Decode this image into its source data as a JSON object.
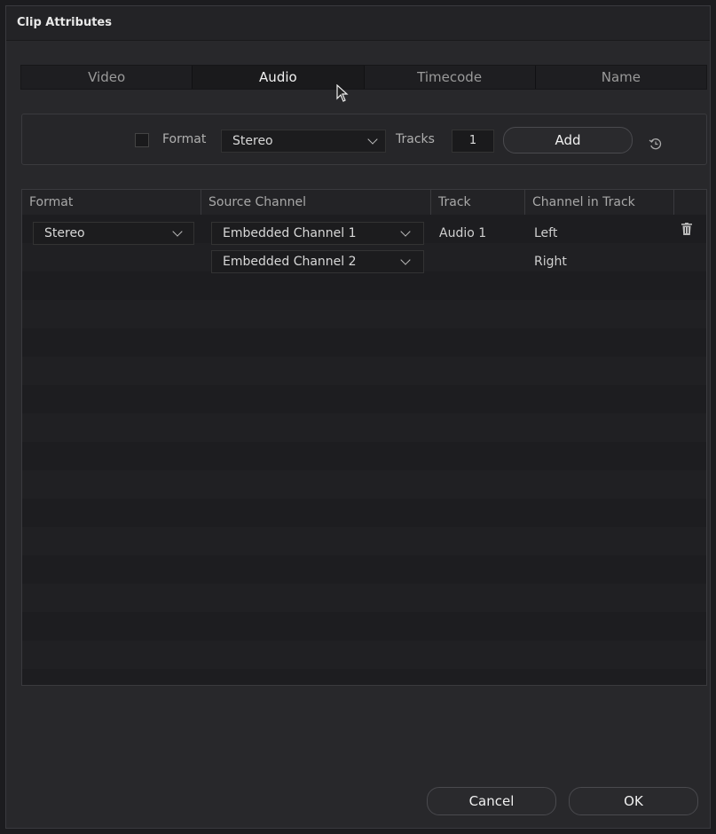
{
  "window": {
    "title": "Clip Attributes"
  },
  "tabs": [
    {
      "label": "Video",
      "active": false
    },
    {
      "label": "Audio",
      "active": true
    },
    {
      "label": "Timecode",
      "active": false
    },
    {
      "label": "Name",
      "active": false
    }
  ],
  "format_bar": {
    "format_checkbox_label": "Format",
    "format_select_value": "Stereo",
    "tracks_label": "Tracks",
    "tracks_value": "1",
    "add_label": "Add"
  },
  "table": {
    "columns": [
      "Format",
      "Source Channel",
      "Track",
      "Channel in Track"
    ],
    "rows": [
      {
        "format": "Stereo",
        "source_channel": "Embedded Channel 1",
        "track": "Audio 1",
        "channel_in_track": "Left"
      },
      {
        "format": "",
        "source_channel": "Embedded Channel 2",
        "track": "",
        "channel_in_track": "Right"
      }
    ]
  },
  "footer": {
    "cancel_label": "Cancel",
    "ok_label": "OK"
  },
  "icons": {
    "chevron": "chevron-down-icon",
    "reset": "reset-icon",
    "trash": "trash-icon",
    "cursor": "mouse-cursor-icon"
  },
  "colors": {
    "background": "#28282b",
    "panel": "#1f1f22",
    "text": "#c8c8c8"
  }
}
